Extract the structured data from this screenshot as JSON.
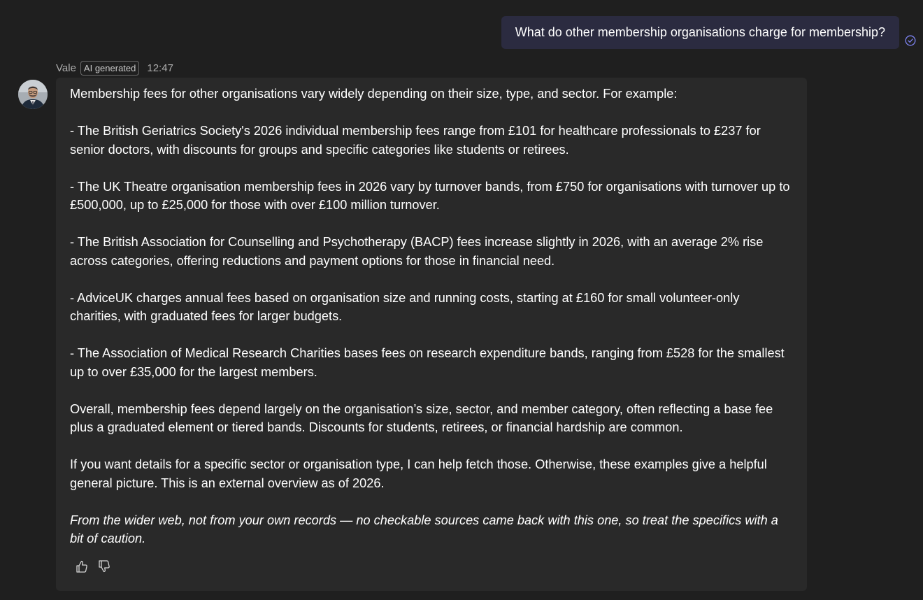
{
  "user_message": {
    "text": "What do other membership organisations charge for membership?"
  },
  "bot_message": {
    "sender": "Vale",
    "badge": "AI generated",
    "time": "12:47",
    "paragraphs": [
      "Membership fees for other organisations vary widely depending on their size, type, and sector. For example:",
      "- The British Geriatrics Society's 2026 individual membership fees range from £101 for healthcare professionals to £237 for senior doctors, with discounts for groups and specific categories like students or retirees.",
      "- The UK Theatre organisation membership fees in 2026 vary by turnover bands, from £750 for organisations with turnover up to £500,000, up to £25,000 for those with over £100 million turnover.",
      "- The British Association for Counselling and Psychotherapy (BACP) fees increase slightly in 2026, with an average 2% rise across categories, offering reductions and payment options for those in financial need.",
      "- AdviceUK charges annual fees based on organisation size and running costs, starting at £160 for small volunteer-only charities, with graduated fees for larger budgets.",
      "- The Association of Medical Research Charities bases fees on research expenditure bands, ranging from £528 for the smallest up to over £35,000 for the largest members.",
      "Overall, membership fees depend largely on the organisation’s size, sector, and member category, often reflecting a base fee plus a graduated element or tiered bands. Discounts for students, retirees, or financial hardship are common.",
      "If you want details for a specific sector or organisation type, I can help fetch those. Otherwise, these examples give a helpful general picture. This is an external overview as of 2026."
    ],
    "disclaimer": "From the wider web, not from your own records — no checkable sources came back with this one, so treat the specifics with a bit of caution."
  },
  "icons": {
    "read_receipt": "check-circle-icon",
    "like": "thumbs-up-icon",
    "dislike": "thumbs-down-icon"
  },
  "colors": {
    "background": "#1f1f1f",
    "user_bubble": "#2b2b40",
    "bot_bubble": "#292929",
    "receipt": "#7f85f5"
  }
}
